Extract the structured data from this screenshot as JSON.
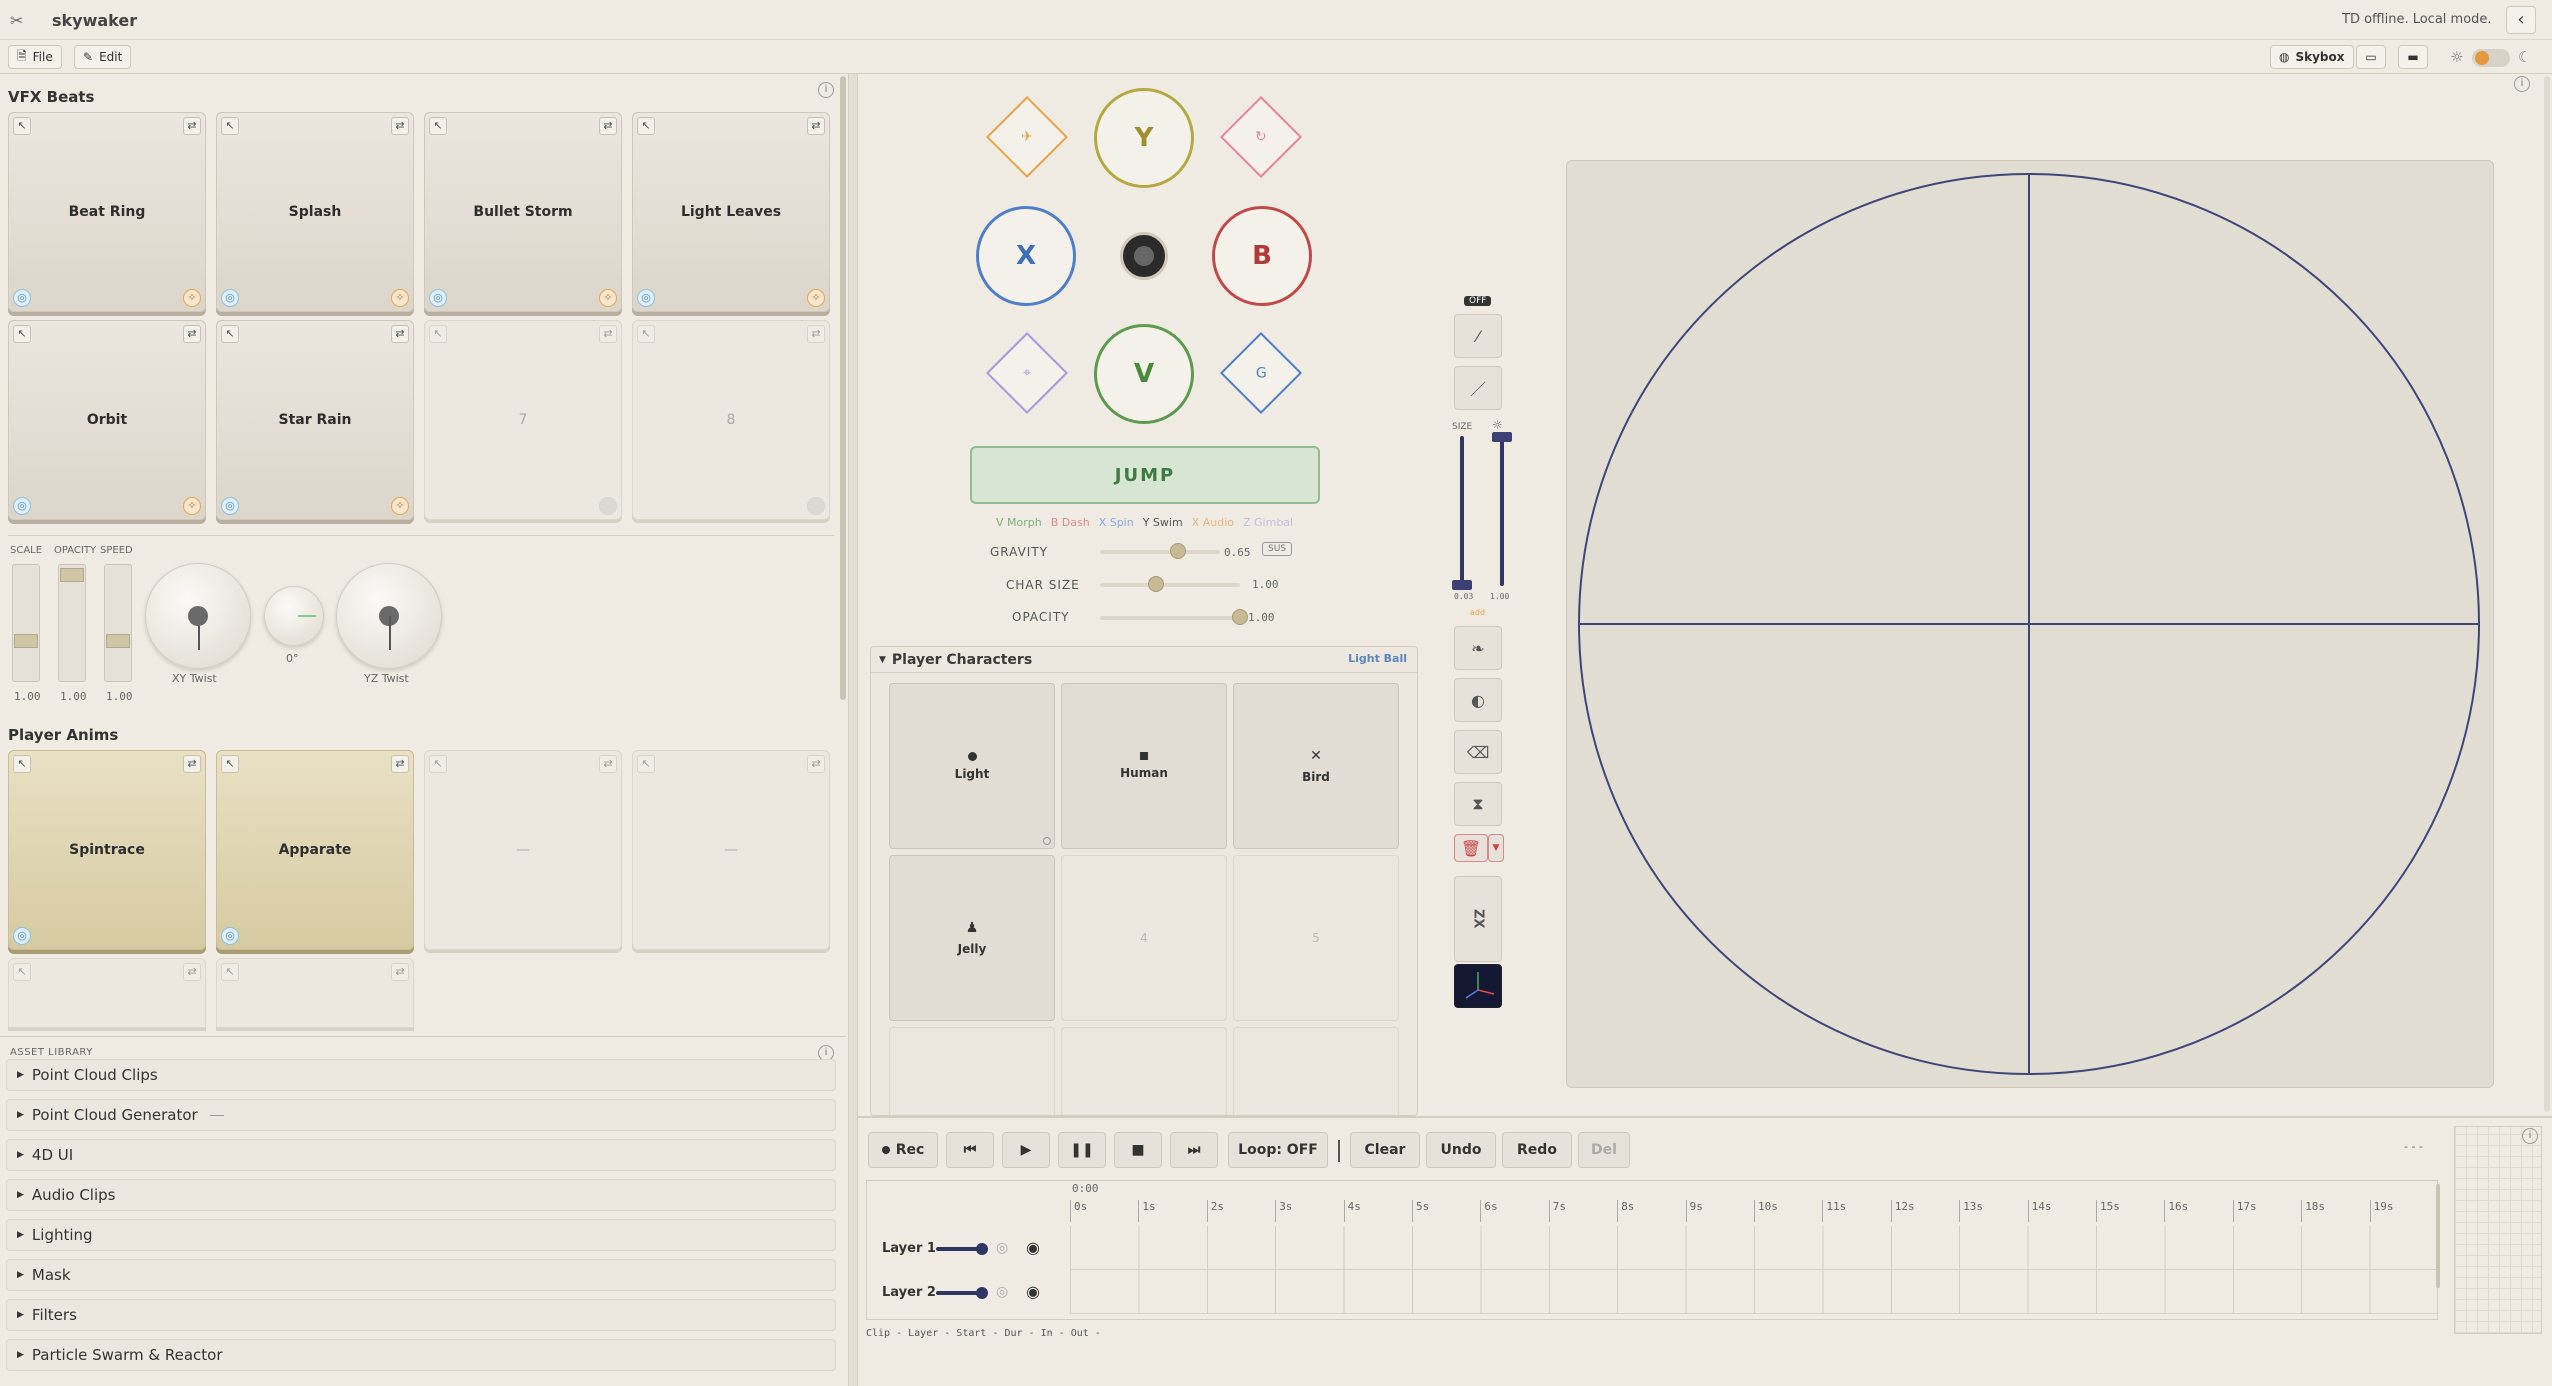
{
  "app": {
    "title": "skywaker",
    "status": "TD offline. Local mode."
  },
  "toolbar": {
    "file": "File",
    "edit": "Edit",
    "skybox": "Skybox"
  },
  "vfx": {
    "title": "VFX Beats",
    "pads": [
      {
        "label": "Beat Ring"
      },
      {
        "label": "Splash"
      },
      {
        "label": "Bullet Storm"
      },
      {
        "label": "Light Leaves"
      },
      {
        "label": "Orbit"
      },
      {
        "label": "Star Rain"
      },
      {
        "label": "7"
      },
      {
        "label": "8"
      }
    ]
  },
  "sliders": {
    "scale_label": "SCALE",
    "opacity_label": "OPACITY",
    "speed_label": "SPEED",
    "scale_val": "1.00",
    "opacity_val": "1.00",
    "speed_val": "1.00",
    "xy_twist": "XY Twist",
    "center_angle": "0°",
    "yz_twist": "YZ Twist"
  },
  "anims": {
    "title": "Player Anims",
    "pads": [
      {
        "label": "Spintrace"
      },
      {
        "label": "Apparate"
      },
      {
        "label": "—"
      },
      {
        "label": "—"
      }
    ]
  },
  "assets": {
    "title": "ASSET LIBRARY",
    "items": [
      "Point Cloud Clips",
      "Point Cloud Generator",
      "4D UI",
      "Audio Clips",
      "Lighting",
      "Mask",
      "Filters",
      "Particle Swarm & Reactor"
    ]
  },
  "gamepad": {
    "y": "Y",
    "x": "X",
    "b": "B",
    "v": "V",
    "jump": "JUMP",
    "legend": [
      {
        "text": "V Morph",
        "color": "#7fae7a"
      },
      {
        "text": "B Dash",
        "color": "#d98d8d"
      },
      {
        "text": "X Spin",
        "color": "#8aa8e0"
      },
      {
        "text": "Y Swim",
        "color": "#555555"
      },
      {
        "text": "X Audio",
        "color": "#e8b884"
      },
      {
        "text": "Z Gimbal",
        "color": "#c6bde6"
      }
    ]
  },
  "params": {
    "gravity_label": "GRAVITY",
    "gravity_val": "0.65",
    "gravity": 0.65,
    "sus": "SUS",
    "charsize_label": "CHAR SIZE",
    "charsize_val": "1.00",
    "charsize": 0.4,
    "opacity_label": "OPACITY",
    "opacity_val": "1.00",
    "opacity": 1.0
  },
  "characters": {
    "title": "Player Characters",
    "badge": "Light Ball",
    "slots": [
      {
        "label": "Light"
      },
      {
        "label": "Human"
      },
      {
        "label": "Bird"
      },
      {
        "label": "Jelly"
      },
      {
        "label": "4"
      },
      {
        "label": "5"
      }
    ]
  },
  "tools": {
    "off": "OFF",
    "size": "SIZE",
    "size_min": "0.03",
    "bright_val": "1.00",
    "add": "add"
  },
  "timeline": {
    "rec": "Rec",
    "loop": "Loop: OFF",
    "clear": "Clear",
    "undo": "Undo",
    "redo": "Redo",
    "del": "Del",
    "time": "0:00",
    "ticks": [
      "0s",
      "1s",
      "2s",
      "3s",
      "4s",
      "5s",
      "6s",
      "7s",
      "8s",
      "9s",
      "10s",
      "11s",
      "12s",
      "13s",
      "14s",
      "15s",
      "16s",
      "17s",
      "18s",
      "19s"
    ],
    "layers": [
      "Layer 1",
      "Layer 2"
    ],
    "footer": "Clip - Layer - Start - Dur - In - Out -",
    "dots": "- - -"
  }
}
